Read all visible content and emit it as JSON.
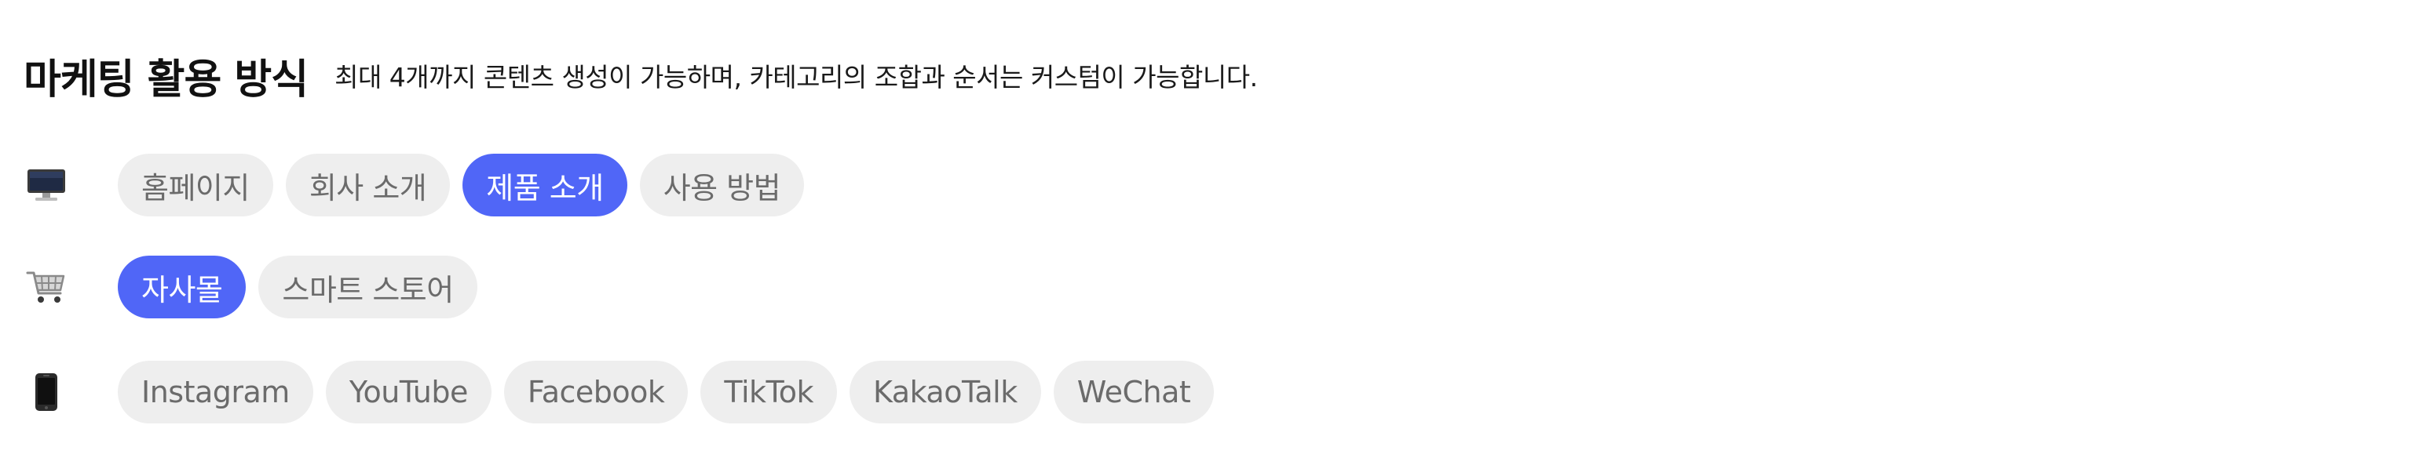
{
  "header": {
    "title": "마케팅 활용 방식",
    "subtitle": "최대 4개까지 콘텐츠 생성이 가능하며, 카테고리의 조합과 순서는 커스텀이 가능합니다."
  },
  "rows": [
    {
      "icon": "desktop-computer-icon",
      "chips": [
        {
          "label": "홈페이지",
          "selected": false
        },
        {
          "label": "회사 소개",
          "selected": false
        },
        {
          "label": "제품 소개",
          "selected": true
        },
        {
          "label": "사용 방법",
          "selected": false
        }
      ]
    },
    {
      "icon": "shopping-cart-icon",
      "chips": [
        {
          "label": "자사몰",
          "selected": true
        },
        {
          "label": "스마트 스토어",
          "selected": false
        }
      ]
    },
    {
      "icon": "mobile-phone-icon",
      "chips": [
        {
          "label": "Instagram",
          "selected": false
        },
        {
          "label": "YouTube",
          "selected": false
        },
        {
          "label": "Facebook",
          "selected": false
        },
        {
          "label": "TikTok",
          "selected": false
        },
        {
          "label": "KakaoTalk",
          "selected": false
        },
        {
          "label": "WeChat",
          "selected": false
        }
      ]
    }
  ],
  "colors": {
    "selected_bg": "#5066f7",
    "chip_bg": "#eeeeee",
    "chip_text": "#6b6b6b",
    "selected_text": "#ffffff"
  }
}
